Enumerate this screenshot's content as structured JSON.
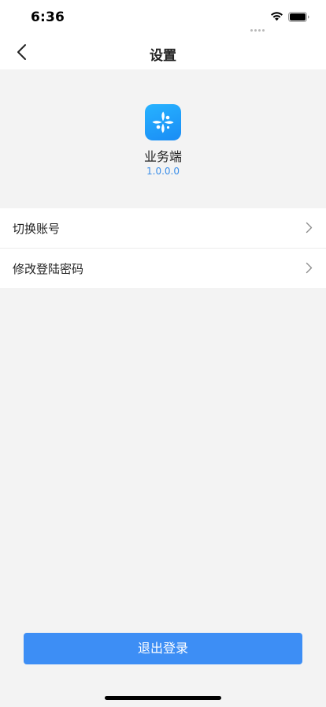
{
  "status_bar": {
    "time": "6:36",
    "icons": [
      "signal-dots-icon",
      "wifi-icon",
      "battery-icon"
    ]
  },
  "nav": {
    "back_icon": "chevron-left-icon",
    "title": "设置"
  },
  "app": {
    "logo_icon": "app-logo-icon",
    "name": "业务端",
    "version": "1.0.0.0"
  },
  "settings": {
    "items": [
      {
        "label": "切换账号",
        "icon": "chevron-right-icon"
      },
      {
        "label": "修改登陆密码",
        "icon": "chevron-right-icon"
      }
    ]
  },
  "logout": {
    "label": "退出登录"
  },
  "colors": {
    "background": "#f3f3f3",
    "accent": "#3d8ef5",
    "version_text": "#3b8ee8",
    "logo_gradient_start": "#27b3ff",
    "logo_gradient_end": "#1a8cf5"
  }
}
